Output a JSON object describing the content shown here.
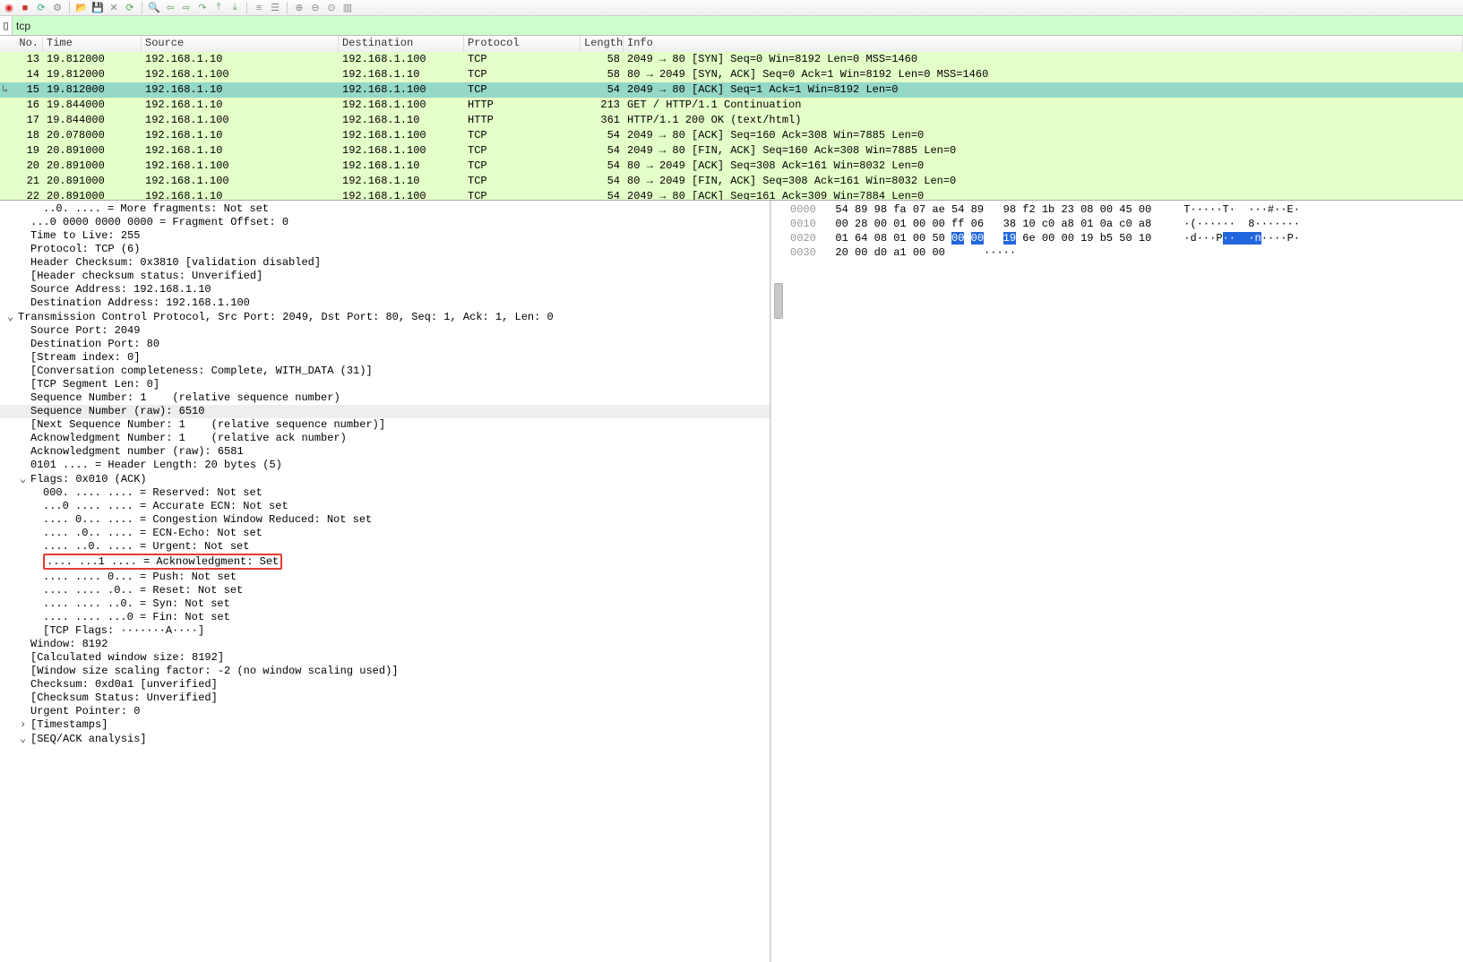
{
  "filter": {
    "value": "tcp"
  },
  "packet_list": {
    "columns": [
      "No.",
      "Time",
      "Source",
      "Destination",
      "Protocol",
      "Length",
      "Info"
    ],
    "rows": [
      {
        "no": "13",
        "time": "19.812000",
        "src": "192.168.1.10",
        "dst": "192.168.1.100",
        "prot": "TCP",
        "len": "58",
        "info": "2049 → 80 [SYN] Seq=0 Win=8192 Len=0 MSS=1460",
        "bg": "green"
      },
      {
        "no": "14",
        "time": "19.812000",
        "src": "192.168.1.100",
        "dst": "192.168.1.10",
        "prot": "TCP",
        "len": "58",
        "info": "80 → 2049 [SYN, ACK] Seq=0 Ack=1 Win=8192 Len=0 MSS=1460",
        "bg": "green"
      },
      {
        "no": "15",
        "time": "19.812000",
        "src": "192.168.1.10",
        "dst": "192.168.1.100",
        "prot": "TCP",
        "len": "54",
        "info": "2049 → 80 [ACK] Seq=1 Ack=1 Win=8192 Len=0",
        "bg": "green",
        "sel": true
      },
      {
        "no": "16",
        "time": "19.844000",
        "src": "192.168.1.10",
        "dst": "192.168.1.100",
        "prot": "HTTP",
        "len": "213",
        "info": "GET / HTTP/1.1 Continuation",
        "bg": "green"
      },
      {
        "no": "17",
        "time": "19.844000",
        "src": "192.168.1.100",
        "dst": "192.168.1.10",
        "prot": "HTTP",
        "len": "361",
        "info": "HTTP/1.1 200 OK  (text/html)",
        "bg": "green"
      },
      {
        "no": "18",
        "time": "20.078000",
        "src": "192.168.1.10",
        "dst": "192.168.1.100",
        "prot": "TCP",
        "len": "54",
        "info": "2049 → 80 [ACK] Seq=160 Ack=308 Win=7885 Len=0",
        "bg": "green"
      },
      {
        "no": "19",
        "time": "20.891000",
        "src": "192.168.1.10",
        "dst": "192.168.1.100",
        "prot": "TCP",
        "len": "54",
        "info": "2049 → 80 [FIN, ACK] Seq=160 Ack=308 Win=7885 Len=0",
        "bg": "green"
      },
      {
        "no": "20",
        "time": "20.891000",
        "src": "192.168.1.100",
        "dst": "192.168.1.10",
        "prot": "TCP",
        "len": "54",
        "info": "80 → 2049 [ACK] Seq=308 Ack=161 Win=8032 Len=0",
        "bg": "green"
      },
      {
        "no": "21",
        "time": "20.891000",
        "src": "192.168.1.100",
        "dst": "192.168.1.10",
        "prot": "TCP",
        "len": "54",
        "info": "80 → 2049 [FIN, ACK] Seq=308 Ack=161 Win=8032 Len=0",
        "bg": "green"
      },
      {
        "no": "22",
        "time": "20.891000",
        "src": "192.168.1.10",
        "dst": "192.168.1.100",
        "prot": "TCP",
        "len": "54",
        "info": "2049 → 80 [ACK] Seq=161 Ack=309 Win=7884 Len=0",
        "bg": "green"
      }
    ]
  },
  "details": {
    "lines": [
      {
        "indent": 2,
        "text": "..0. .... = More fragments: Not set"
      },
      {
        "indent": 1,
        "text": "...0 0000 0000 0000 = Fragment Offset: 0"
      },
      {
        "indent": 1,
        "text": "Time to Live: 255"
      },
      {
        "indent": 1,
        "text": "Protocol: TCP (6)"
      },
      {
        "indent": 1,
        "text": "Header Checksum: 0x3810 [validation disabled]"
      },
      {
        "indent": 1,
        "text": "[Header checksum status: Unverified]"
      },
      {
        "indent": 1,
        "text": "Source Address: 192.168.1.10"
      },
      {
        "indent": 1,
        "text": "Destination Address: 192.168.1.100"
      },
      {
        "indent": 0,
        "exp": "v",
        "text": "Transmission Control Protocol, Src Port: 2049, Dst Port: 80, Seq: 1, Ack: 1, Len: 0"
      },
      {
        "indent": 1,
        "text": "Source Port: 2049"
      },
      {
        "indent": 1,
        "text": "Destination Port: 80"
      },
      {
        "indent": 1,
        "text": "[Stream index: 0]"
      },
      {
        "indent": 1,
        "text": "[Conversation completeness: Complete, WITH_DATA (31)]"
      },
      {
        "indent": 1,
        "text": "[TCP Segment Len: 0]"
      },
      {
        "indent": 1,
        "text": "Sequence Number: 1    (relative sequence number)"
      },
      {
        "indent": 1,
        "text": "Sequence Number (raw): 6510",
        "hl": true
      },
      {
        "indent": 1,
        "text": "[Next Sequence Number: 1    (relative sequence number)]"
      },
      {
        "indent": 1,
        "text": "Acknowledgment Number: 1    (relative ack number)"
      },
      {
        "indent": 1,
        "text": "Acknowledgment number (raw): 6581"
      },
      {
        "indent": 1,
        "text": "0101 .... = Header Length: 20 bytes (5)"
      },
      {
        "indent": 0,
        "exp": "v",
        "pad": 22,
        "text": "Flags: 0x010 (ACK)"
      },
      {
        "indent": 2,
        "text": "000. .... .... = Reserved: Not set"
      },
      {
        "indent": 2,
        "text": "...0 .... .... = Accurate ECN: Not set"
      },
      {
        "indent": 2,
        "text": ".... 0... .... = Congestion Window Reduced: Not set"
      },
      {
        "indent": 2,
        "text": ".... .0.. .... = ECN-Echo: Not set"
      },
      {
        "indent": 2,
        "text": ".... ..0. .... = Urgent: Not set"
      },
      {
        "indent": 2,
        "text": ".... ...1 .... = Acknowledgment: Set",
        "redbox": true
      },
      {
        "indent": 2,
        "text": ".... .... 0... = Push: Not set"
      },
      {
        "indent": 2,
        "text": ".... .... .0.. = Reset: Not set"
      },
      {
        "indent": 2,
        "text": ".... .... ..0. = Syn: Not set"
      },
      {
        "indent": 2,
        "text": ".... .... ...0 = Fin: Not set"
      },
      {
        "indent": 2,
        "text": "[TCP Flags: ·······A····]"
      },
      {
        "indent": 1,
        "text": "Window: 8192"
      },
      {
        "indent": 1,
        "text": "[Calculated window size: 8192]"
      },
      {
        "indent": 1,
        "text": "[Window size scaling factor: -2 (no window scaling used)]"
      },
      {
        "indent": 1,
        "text": "Checksum: 0xd0a1 [unverified]"
      },
      {
        "indent": 1,
        "text": "[Checksum Status: Unverified]"
      },
      {
        "indent": 1,
        "text": "Urgent Pointer: 0"
      },
      {
        "indent": 0,
        "exp": ">",
        "pad": 22,
        "text": "[Timestamps]"
      },
      {
        "indent": 0,
        "exp": "v",
        "pad": 22,
        "text": "[SEQ/ACK analysis]"
      }
    ]
  },
  "hex": {
    "rows": [
      {
        "off": "0000",
        "bytes": [
          "54",
          "89",
          "98",
          "fa",
          "07",
          "ae",
          "54",
          "89",
          "",
          "98",
          "f2",
          "1b",
          "23",
          "08",
          "00",
          "45",
          "00"
        ],
        "ascii": "T·····T·  ···#··E·"
      },
      {
        "off": "0010",
        "bytes": [
          "00",
          "28",
          "00",
          "01",
          "00",
          "00",
          "ff",
          "06",
          "",
          "38",
          "10",
          "c0",
          "a8",
          "01",
          "0a",
          "c0",
          "a8"
        ],
        "ascii": "·(······  8·······"
      },
      {
        "off": "0020",
        "bytes": [
          "01",
          "64",
          "08",
          "01",
          "00",
          "50",
          "00",
          "00",
          "",
          "19",
          "6e",
          "00",
          "00",
          "19",
          "b5",
          "50",
          "10"
        ],
        "ascii": "·d···P··  ·n····P·",
        "selStart": 6,
        "selEnd": 10
      },
      {
        "off": "0030",
        "bytes": [
          "20",
          "00",
          "d0",
          "a1",
          "00",
          "00"
        ],
        "ascii": " ·····"
      }
    ]
  },
  "toolbar_icons": [
    "record",
    "stop",
    "restart",
    "options",
    "open",
    "save",
    "close",
    "reload",
    "find",
    "back",
    "fwd",
    "jump",
    "first",
    "last",
    "autoscroll",
    "colorize",
    "zoom-in",
    "zoom-out",
    "zoom-reset",
    "resize-cols"
  ]
}
